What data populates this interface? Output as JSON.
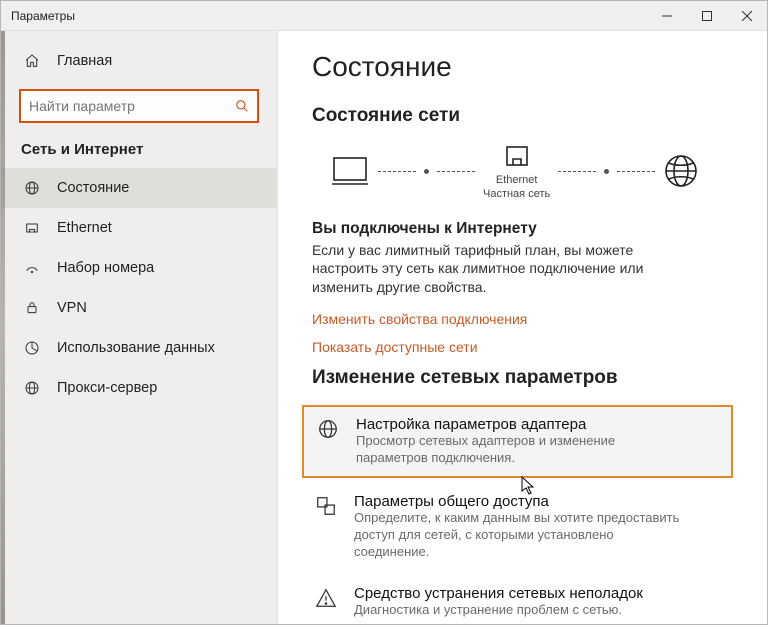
{
  "window": {
    "title": "Параметры"
  },
  "sidebar": {
    "home": "Главная",
    "search_placeholder": "Найти параметр",
    "section": "Сеть и Интернет",
    "items": [
      {
        "label": "Состояние"
      },
      {
        "label": "Ethernet"
      },
      {
        "label": "Набор номера"
      },
      {
        "label": "VPN"
      },
      {
        "label": "Использование данных"
      },
      {
        "label": "Прокси-сервер"
      }
    ]
  },
  "main": {
    "h1": "Состояние",
    "h2": "Состояние сети",
    "diagram": {
      "eth": "Ethernet",
      "eth_sub": "Частная сеть"
    },
    "connected": {
      "title": "Вы подключены к Интернету",
      "desc": "Если у вас лимитный тарифный план, вы можете настроить эту сеть как лимитное подключение или изменить другие свойства."
    },
    "links": {
      "change_props": "Изменить свойства подключения",
      "show_nets": "Показать доступные сети"
    },
    "change_section": "Изменение сетевых параметров",
    "options": [
      {
        "title": "Настройка параметров адаптера",
        "desc": "Просмотр сетевых адаптеров и изменение параметров подключения."
      },
      {
        "title": "Параметры общего доступа",
        "desc": "Определите, к каким данным вы хотите предоставить доступ для сетей, с которыми установлено соединение."
      },
      {
        "title": "Средство устранения сетевых неполадок",
        "desc": "Диагностика и устранение проблем с сетью."
      }
    ]
  }
}
